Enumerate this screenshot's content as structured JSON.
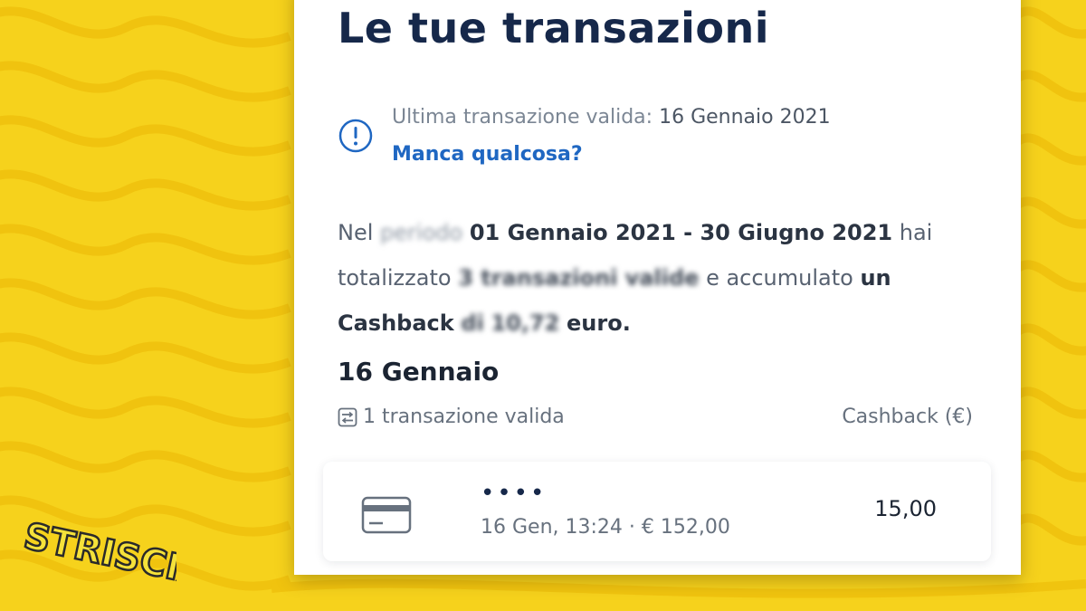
{
  "screen": {
    "title": "Le tue transazioni",
    "last_transaction_label": "Ultima transazione valida: ",
    "last_transaction_date": "16 Gennaio 2021",
    "missing_link": "Manca qualcosa?",
    "summary": {
      "p1": "Nel",
      "p1_blur": "periodo",
      "period": "01 Gennaio 2021 - 30 Giugno 2021",
      "p2": "hai totalizzato",
      "count": "3 transazioni valide",
      "p3": "e accumulato",
      "p4": "un Cashback",
      "p5": "di",
      "amount_blur": "10,72",
      "amount_suffix": "euro."
    },
    "day_header": "16 Gennaio",
    "day_count": "1 transazione valida",
    "cashback_col": "Cashback (€)",
    "transaction": {
      "masked_card": "••••",
      "detail": "16 Gen, 13:24 · € 152,00",
      "cashback": "15,00"
    }
  },
  "overlay": {
    "logo_text": "STRISCIA",
    "background_color": "#f6d21c"
  },
  "icons": {
    "info": "exclamation-circle-icon",
    "transactions": "transactions-list-icon",
    "card": "credit-card-icon"
  },
  "colors": {
    "title": "#16284a",
    "link": "#1f67c2",
    "muted": "#7b8694"
  }
}
